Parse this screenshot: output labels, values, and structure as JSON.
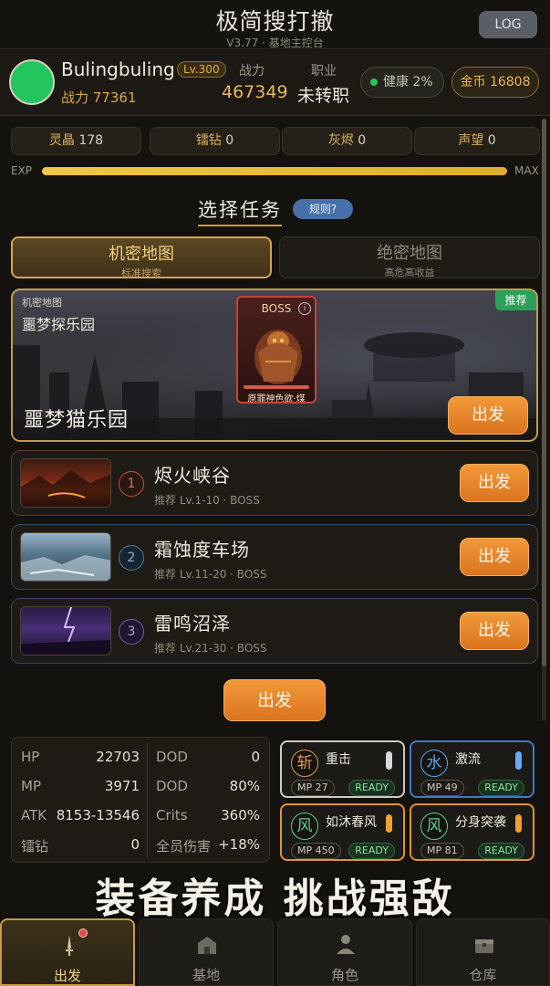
{
  "header": {
    "title": "极简搜打撤",
    "version": "V3.77",
    "subtitle": "基地主控台",
    "log_label": "LOG"
  },
  "player": {
    "name": "Bulingbuling",
    "level": "Lv.300",
    "power_text": "战力 77361",
    "avatar_color": "#22c55e"
  },
  "stats_top": {
    "power_label": "战力",
    "power_value": "467349",
    "job_label": "职业",
    "job_value": "未转职",
    "health": "健康 2%",
    "gold": "金币 16808"
  },
  "resources": [
    {
      "name": "灵晶",
      "value": "178"
    },
    {
      "name": "镭钻",
      "value": "0"
    },
    {
      "name": "灰烬",
      "value": "0"
    },
    {
      "name": "声望",
      "value": "0"
    }
  ],
  "exp": {
    "label": "EXP",
    "max_label": "MAX",
    "progress": 1.0
  },
  "task": {
    "title": "选择任务",
    "rules": "规则?"
  },
  "map_tabs": [
    {
      "title": "机密地图",
      "sub": "标准搜索",
      "active": true
    },
    {
      "title": "绝密地图",
      "sub": "高危高收益",
      "active": false
    }
  ],
  "featured": {
    "category": "机密地图",
    "location": "噩梦探乐园",
    "title": "噩梦猫乐园",
    "badge": "推荐",
    "boss_label": "BOSS",
    "boss_info": "i",
    "boss_name": "原罪神色欲·煤",
    "go": "出发"
  },
  "stages": [
    {
      "num": "1",
      "name": "烬火峡谷",
      "rec": "推荐 Lv.1-10 · BOSS",
      "go": "出发",
      "theme": "fire"
    },
    {
      "num": "2",
      "name": "霜蚀度车场",
      "rec": "推荐 Lv.11-20 · BOSS",
      "go": "出发",
      "theme": "frost"
    },
    {
      "num": "3",
      "name": "雷鸣沼泽",
      "rec": "推荐 Lv.21-30 · BOSS",
      "go": "出发",
      "theme": "thunder"
    }
  ],
  "main_go": "出发",
  "combat_stats": [
    {
      "label": "HP",
      "value": "22703"
    },
    {
      "label": "DOD",
      "value": "0"
    },
    {
      "label": "MP",
      "value": "3971"
    },
    {
      "label": "DOD",
      "value": "80%"
    },
    {
      "label": "ATK",
      "value": "8153-13546"
    },
    {
      "label": "Crits",
      "value": "360%"
    },
    {
      "label": "镭钻",
      "value": "0"
    },
    {
      "label": "全员伤害",
      "value": "+18%"
    }
  ],
  "skills": [
    {
      "icon": "斩",
      "name": "重击",
      "mp": "MP 27",
      "status": "READY",
      "border": "#cfcac0",
      "icon_color": "#e49a4a",
      "gem": "#d8d8d8"
    },
    {
      "icon": "水",
      "name": "激流",
      "mp": "MP 49",
      "status": "READY",
      "border": "#3f78c8",
      "icon_color": "#5fa4f0",
      "gem": "#6aa6ff"
    },
    {
      "icon": "风",
      "name": "如沐春风",
      "mp": "MP 450",
      "status": "READY",
      "border": "#e0952e",
      "icon_color": "#5fd08a",
      "gem": "#f0a030"
    },
    {
      "icon": "风",
      "name": "分身突袭",
      "mp": "MP 81",
      "status": "READY",
      "border": "#e0952e",
      "icon_color": "#5fd08a",
      "gem": "#f0a030"
    }
  ],
  "slogan": "装备养成 挑战强敌",
  "nav": [
    {
      "label": "出发",
      "icon": "sword-icon",
      "active": true
    },
    {
      "label": "基地",
      "icon": "base-icon",
      "active": false
    },
    {
      "label": "角色",
      "icon": "person-icon",
      "active": false
    },
    {
      "label": "仓库",
      "icon": "chest-icon",
      "active": false
    }
  ]
}
